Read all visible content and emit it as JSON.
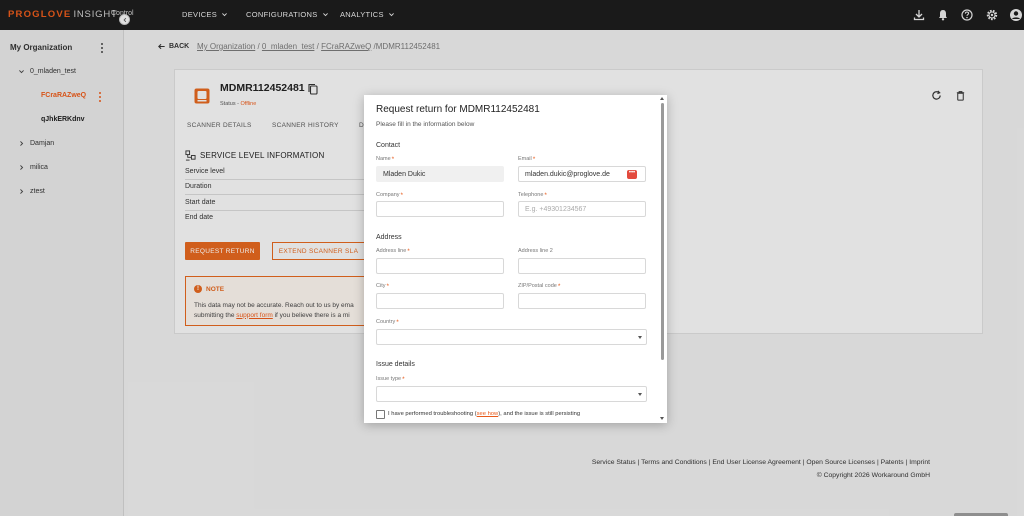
{
  "topbar": {
    "brand": "PROGLOVE",
    "brand_insight": "INSIGHT",
    "brand_sub": "Control",
    "nav": [
      {
        "label": "DEVICES"
      },
      {
        "label": "CONFIGURATIONS"
      },
      {
        "label": "ANALYTICS"
      }
    ],
    "icons": [
      "download-icon",
      "bell-icon",
      "help-icon",
      "settings-icon",
      "account-icon"
    ]
  },
  "sidebar": {
    "title": "My Organization",
    "items": [
      {
        "label": "0_mladen_test",
        "expanded": true
      },
      {
        "label": "FCraRAZweQ",
        "active": true
      },
      {
        "label": "qJhkERKdnv"
      },
      {
        "label": "Damjan"
      },
      {
        "label": "milica"
      },
      {
        "label": "ztest"
      }
    ]
  },
  "breadcrumb": {
    "back": "BACK",
    "crumbs": [
      "My Organization",
      "0_mladen_test",
      "FCraRAZweQ"
    ],
    "current": "/MDMR112452481"
  },
  "device": {
    "title": "MDMR112452481",
    "status_label": "Status - ",
    "status_value": "Offline",
    "tabs": [
      "SCANNER DETAILS",
      "SCANNER HISTORY",
      "D"
    ],
    "sli_title": "SERVICE LEVEL INFORMATION",
    "sli_rows": [
      "Service level",
      "Duration",
      "Start date",
      "End date"
    ],
    "btn_request": "REQUEST RETURN",
    "btn_extend": "EXTEND SCANNER SLA",
    "note_title": "NOTE",
    "note_line1": "This data may not be accurate. Reach out to us by ema",
    "note_line2_a": "submitting the ",
    "note_link": "support form",
    "note_line2_b": " if you believe there is a mi"
  },
  "footer": {
    "links": "Service Status | Terms and Conditions | End User License Agreement | Open Source Licenses | Patents | Imprint",
    "copyright": "© Copyright 2026 Workaround GmbH"
  },
  "modal": {
    "title": "Request return for MDMR112452481",
    "subtitle": "Please fill in the information below",
    "contact_section": "Contact",
    "name_label": "Name",
    "name_value": "Mladen Dukic",
    "email_label": "Email",
    "email_value": "mladen.dukic@proglove.de",
    "company_label": "Company",
    "company_value": "",
    "telephone_label": "Telephone",
    "telephone_placeholder": "E.g. +49301234567",
    "address_section": "Address",
    "address1_label": "Address line",
    "address2_label": "Address line 2",
    "city_label": "City",
    "zip_label": "ZIP/Postal code",
    "country_label": "Country",
    "issue_section": "Issue details",
    "issue_type_label": "Issue type",
    "checkbox_a": "I have performed troubleshooting (",
    "checkbox_link": "see how",
    "checkbox_b": "), and the issue is still persisting"
  },
  "colors": {
    "accent": "#e85a1a",
    "topbar": "#1d1d1d"
  }
}
